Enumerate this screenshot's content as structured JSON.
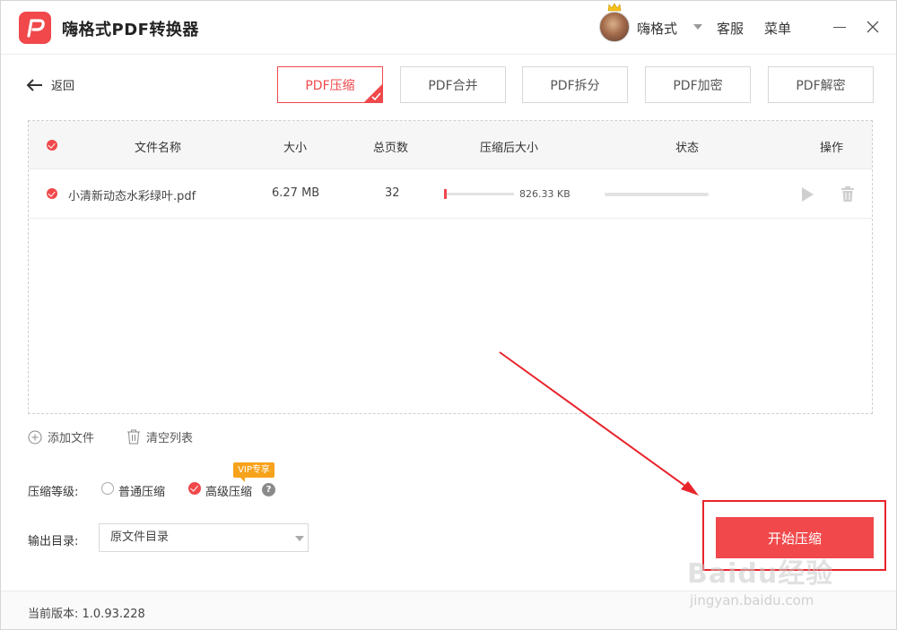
{
  "app": {
    "title": "嗨格式PDF转换器"
  },
  "user": {
    "name": "嗨格式"
  },
  "header": {
    "service": "客服",
    "menu": "菜单"
  },
  "nav": {
    "back_label": "返回"
  },
  "tabs": [
    {
      "label": "PDF压缩",
      "active": true
    },
    {
      "label": "PDF合并",
      "active": false
    },
    {
      "label": "PDF拆分",
      "active": false
    },
    {
      "label": "PDF加密",
      "active": false
    },
    {
      "label": "PDF解密",
      "active": false
    }
  ],
  "table": {
    "headers": {
      "name": "文件名称",
      "size": "大小",
      "pages": "总页数",
      "compressed": "压缩后大小",
      "status": "状态",
      "actions": "操作"
    },
    "rows": [
      {
        "name": "小清新动态水彩绿叶.pdf",
        "size": "6.27 MB",
        "pages": "32",
        "compressed": "826.33 KB",
        "selected": true
      }
    ]
  },
  "controls": {
    "add_file": "添加文件",
    "clear_list": "清空列表",
    "level_label": "压缩等级:",
    "level_options": [
      "普通压缩",
      "高级压缩"
    ],
    "level_selected": "高级压缩",
    "vip_badge": "VIP专享",
    "help": "?",
    "output_label": "输出目录:",
    "output_value": "原文件目录",
    "start_button": "开始压缩"
  },
  "footer": {
    "version": "当前版本: 1.0.93.228"
  },
  "watermark": {
    "main": "Baidu经验",
    "sub": "jingyan.baidu.com"
  },
  "colors": {
    "accent": "#f0484b",
    "vip": "#f7a21b",
    "annotation": "#e8242b"
  }
}
